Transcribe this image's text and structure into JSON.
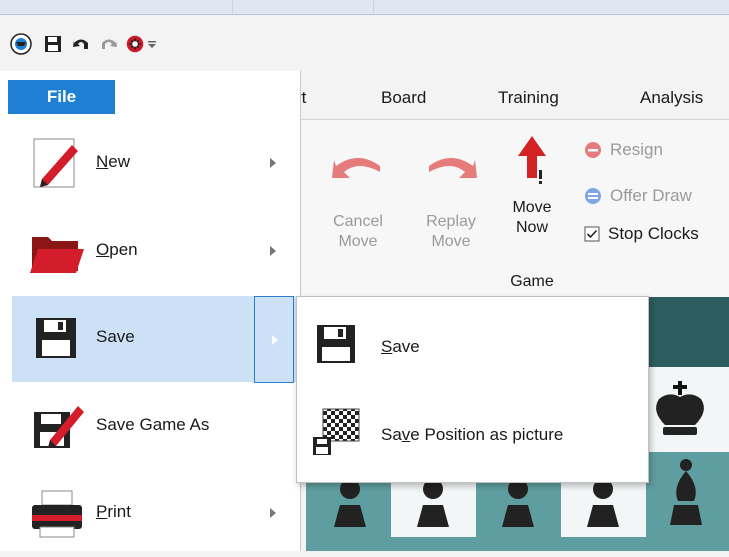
{
  "qat": {
    "icons": [
      "app-logo-icon",
      "save-icon",
      "undo-icon",
      "redo-icon",
      "engine-icon",
      "customize-icon"
    ]
  },
  "tabs": {
    "report_partial": "rt",
    "board": "Board",
    "training": "Training",
    "analysis": "Analysis"
  },
  "file_tab": {
    "label": "File"
  },
  "file_menu": {
    "items": [
      {
        "pre": "",
        "ul": "N",
        "post": "ew",
        "has_arrow": true,
        "icon": "new-document-icon"
      },
      {
        "pre": "",
        "ul": "O",
        "post": "pen",
        "has_arrow": true,
        "icon": "open-folder-icon"
      },
      {
        "pre": "Save",
        "ul": "",
        "post": "",
        "has_arrow": true,
        "icon": "floppy-disk-icon",
        "highlighted": true
      },
      {
        "pre": "Save Game As",
        "ul": "",
        "post": "",
        "has_arrow": false,
        "icon": "save-as-icon"
      },
      {
        "pre": "",
        "ul": "P",
        "post": "rint",
        "has_arrow": true,
        "icon": "printer-icon"
      }
    ]
  },
  "submenu": {
    "items": [
      {
        "pre": "",
        "ul": "S",
        "post": "ave",
        "icon": "floppy-disk-icon"
      },
      {
        "pre": "Sa",
        "ul": "v",
        "post": "e Position as picture",
        "icon": "chessboard-picture-icon"
      }
    ]
  },
  "ribbon": {
    "cancel_move": [
      "Cancel",
      "Move"
    ],
    "replay_move": [
      "Replay",
      "Move"
    ],
    "move_now": [
      "Move",
      "Now"
    ],
    "resign": "Resign",
    "offer_draw": "Offer Draw",
    "stop_clocks": "Stop Clocks",
    "stop_clocks_checked": true,
    "group_label": "Game"
  },
  "colors": {
    "accent": "#1e7fd3",
    "highlight": "#cde1f6",
    "board_light": "#5f9ea0",
    "board_dark": "#2d5d5f",
    "arrow_red": "#d32222"
  }
}
